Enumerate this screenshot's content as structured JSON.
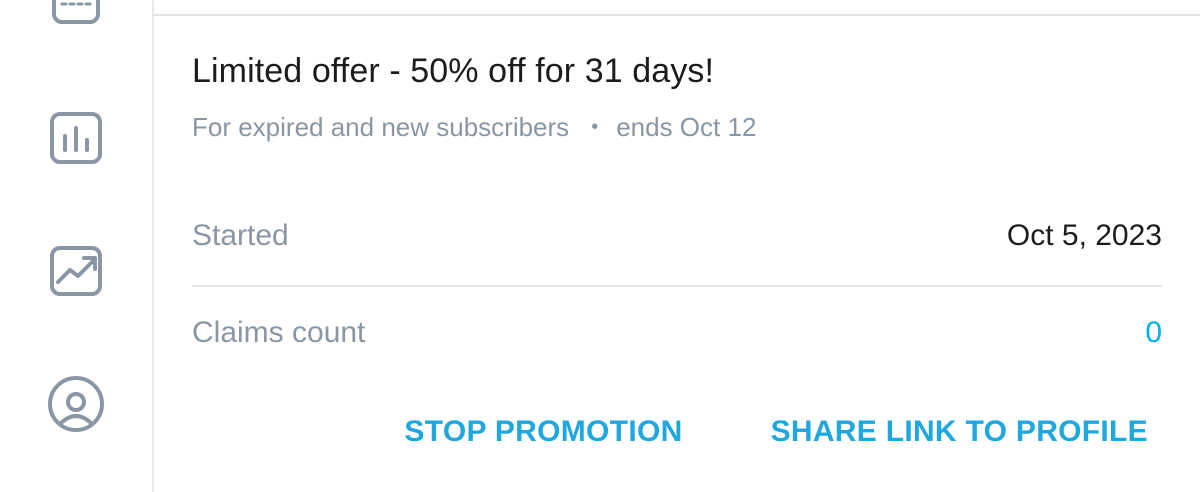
{
  "sidebar": {
    "icons": [
      {
        "name": "calendar-icon"
      },
      {
        "name": "statistics-icon"
      },
      {
        "name": "trending-chart-icon"
      },
      {
        "name": "profile-icon"
      }
    ],
    "icon_color": "#8a96a3"
  },
  "promotion": {
    "title": "Limited offer - 50% off for 31 days!",
    "audience": "For expired and new subscribers",
    "separator": "•",
    "ends": "ends Oct 12",
    "started_label": "Started",
    "started_value": "Oct 5, 2023",
    "claims_label": "Claims count",
    "claims_value": "0"
  },
  "actions": {
    "stop_label": "STOP PROMOTION",
    "share_label": "SHARE LINK TO PROFILE"
  },
  "colors": {
    "accent": "#00aff0",
    "muted_text": "#8a96a3",
    "primary_text": "#1c1c1e",
    "divider": "#e3e5ea"
  }
}
